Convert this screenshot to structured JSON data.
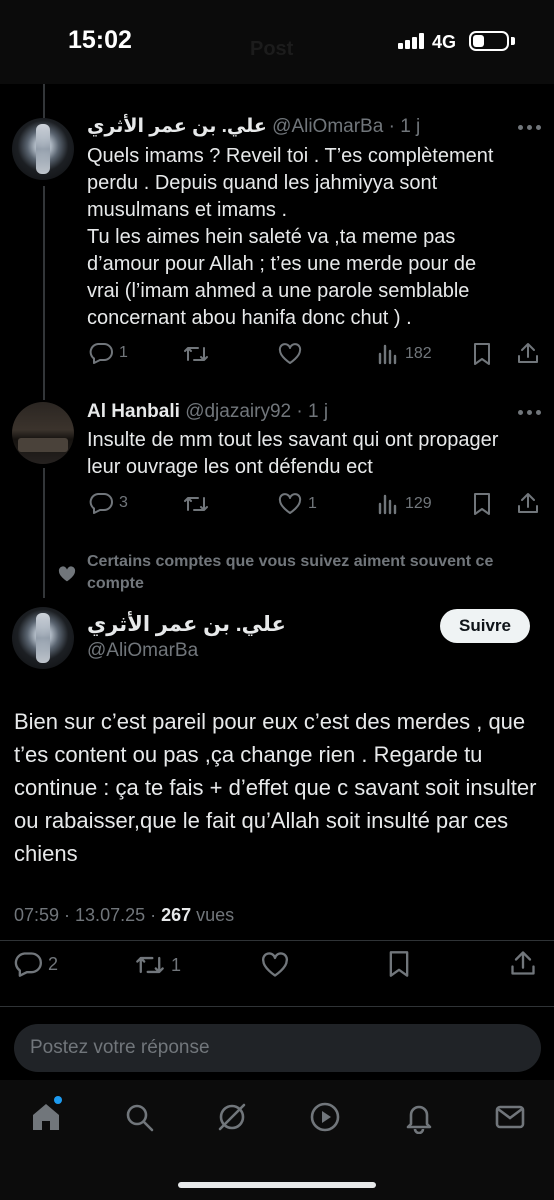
{
  "status_bar": {
    "time": "15:02",
    "network": "4G",
    "header_ghost": "Post"
  },
  "tweets": [
    {
      "display_name": "علي. بن عمر الأثري",
      "handle": "@AliOmarBa",
      "time": "· 1 j",
      "text": "Quels imams ? Reveil toi . T’es complètement\nperdu . Depuis quand les jahmiyya sont\nmusulmans et imams .\nTu les aimes hein saleté va ,ta meme pas\nd’amour pour Allah ; t’es une merde pour de\nvrai (l’imam ahmed a une parole semblable\nconcernant abou hanifa donc chut ) .",
      "replies": "1",
      "retweets": "",
      "likes": "",
      "views": "182"
    },
    {
      "display_name": "Al Hanbali",
      "handle": "@djazairy92",
      "time": "· 1 j",
      "text": "Insulte de mm tout les savant qui ont propager\nleur ouvrage les ont défendu ect",
      "replies": "3",
      "retweets": "",
      "likes": "1",
      "views": "129"
    }
  ],
  "suggestion": "Certains comptes que vous suivez aiment souvent ce compte",
  "main_post": {
    "display_name": "علي. بن عمر الأثري",
    "handle": "@AliOmarBa",
    "follow_label": "Suivre",
    "text": "Bien sur c’est pareil pour eux c’est des merdes , que t’es content ou pas ,ça change rien . Regarde tu continue : ça te fais + d’effet que c savant soit insulter ou rabaisser,que le fait qu’Allah soit insulté par ces chiens",
    "time": "07:59 · 13.07.25 · ",
    "views_count": "267",
    "views_label": " vues",
    "replies": "2",
    "retweets": "1"
  },
  "reply_box": {
    "placeholder": "Postez votre réponse"
  },
  "colors": {
    "background": "#000000",
    "text": "#e7e9ea",
    "muted": "#71767b",
    "accent": "#1d9bf0"
  },
  "icons": [
    "reply-icon",
    "retweet-icon",
    "like-icon",
    "views-icon",
    "bookmark-icon",
    "share-icon",
    "home-icon",
    "search-icon",
    "grok-icon",
    "video-icon",
    "notifications-icon",
    "messages-icon"
  ]
}
